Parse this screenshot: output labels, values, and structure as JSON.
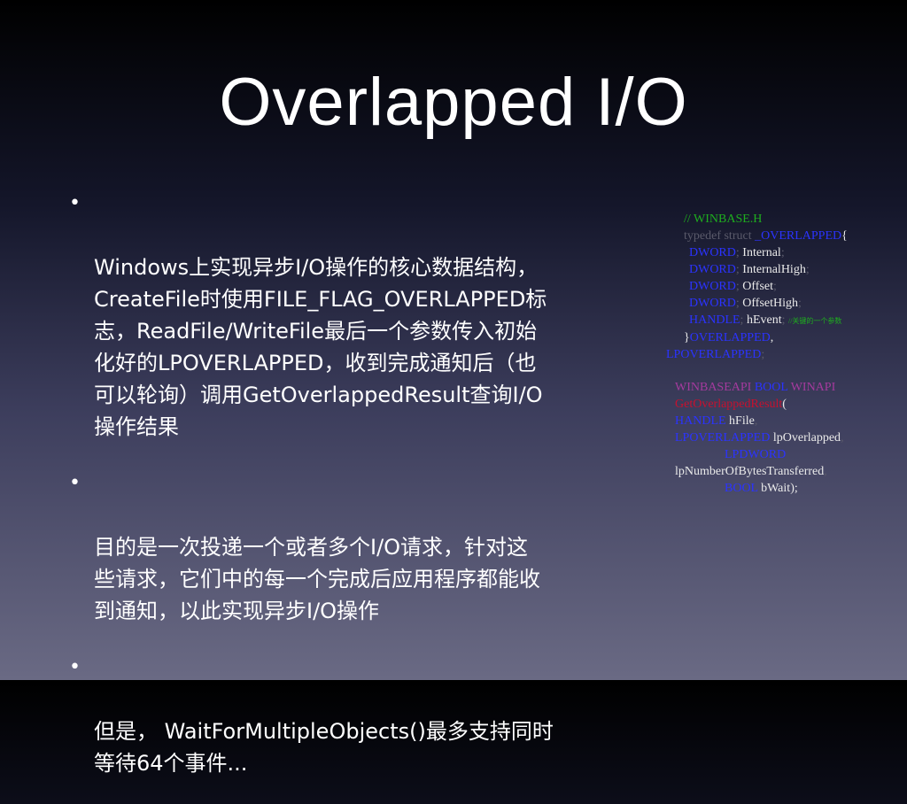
{
  "slide": {
    "title": "Overlapped I/O",
    "bullets": [
      "Windows上实现异步I/O操作的核心数据结构，\nCreateFile时使用FILE_FLAG_OVERLAPPED标\n志，ReadFile/WriteFile最后一个参数传入初始\n化好的LPOVERLAPPED，收到完成通知后（也\n可以轮询）调用GetOverlappedResult查询I/O\n操作结果",
      "目的是一次投递一个或者多个I/O请求，针对这\n些请求，它们中的每一个完成后应用程序都能收\n到通知，以此实现异步I/O操作",
      "但是， WaitForMultipleObjects()最多支持同时\n等待64个事件..."
    ],
    "bullet_glyph": "•"
  },
  "code": {
    "struct": {
      "comment": "// WINBASE.H",
      "typedef": "typedef struct",
      "name": "_OVERLAPPED",
      "brace_open": "{",
      "fields": [
        {
          "type": "DWORD",
          "name": "Internal",
          "sep": ";"
        },
        {
          "type": "DWORD",
          "name": "InternalHigh",
          "sep": ";"
        },
        {
          "type": "DWORD",
          "name": "Offset",
          "sep": ";"
        },
        {
          "type": "DWORD",
          "name": "OffsetHigh",
          "sep": ";"
        },
        {
          "type": "HANDLE",
          "name": "hEvent",
          "sep": ";",
          "comment": "//关键的一个参数"
        }
      ],
      "brace_close": "}",
      "alias1": "OVERLAPPED",
      "comma": ",",
      "alias2": "LPOVERLAPPED",
      "end": ";"
    },
    "api": {
      "decl_winbaseapi": "WINBASEAPI",
      "decl_bool": "BOOL",
      "decl_winapi": "WINAPI",
      "func": "GetOverlappedResult",
      "paren_open": "(",
      "params": [
        {
          "type": "HANDLE",
          "name": "hFile",
          "sep": ","
        },
        {
          "type": "LPOVERLAPPED",
          "name": "lpOverlapped",
          "sep": ","
        },
        {
          "type": "LPDWORD",
          "name": "",
          "sep": ""
        },
        {
          "type": "",
          "name": "lpNumberOfBytesTransferred",
          "sep": ","
        },
        {
          "type": "BOOL",
          "name": "bWait",
          "sep": ");"
        }
      ]
    }
  }
}
